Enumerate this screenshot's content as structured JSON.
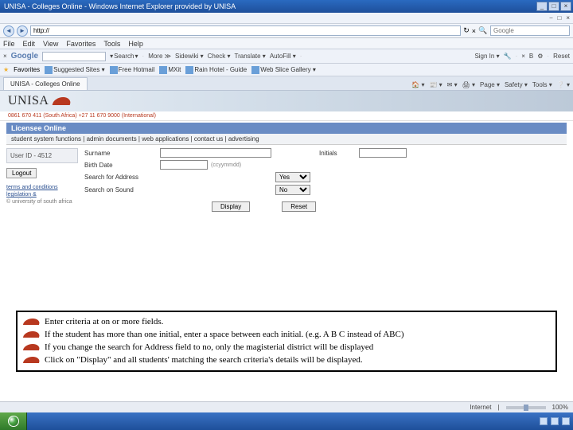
{
  "window": {
    "title": "UNISA - Colleges Online - Windows Internet Explorer provided by UNISA",
    "min": "_",
    "max": "□",
    "close": "×"
  },
  "infobar": {
    "a": "⎯",
    "b": "□",
    "c": "×"
  },
  "addr": {
    "back": "◄",
    "fwd": "►",
    "url": "http://",
    "refresh": "↻",
    "stop": "×",
    "search_placeholder": "Google",
    "mag": "🔍"
  },
  "menu": {
    "file": "File",
    "edit": "Edit",
    "view": "View",
    "favorites": "Favorites",
    "tools": "Tools",
    "help": "Help"
  },
  "tb": {
    "brand": "Google",
    "search": "Search",
    "more": "More ≫",
    "sidewiki": "Sidewiki ▾",
    "check": "Check ▾",
    "translate": "Translate ▾",
    "autofill": "AutoFill ▾",
    "signin": "Sign In ▾",
    "wrench": "🔧",
    "x": "×",
    "gear": "⚙",
    "bold": "B",
    "reset": "Reset"
  },
  "fav": {
    "label": "Favorites",
    "items": [
      "Suggested Sites ▾",
      "Free Hotmail",
      "MXit",
      "Rain Hotel - Guide",
      "Web Slice Gallery ▾"
    ]
  },
  "tab": {
    "title": "UNISA - Colleges Online"
  },
  "tabtools": {
    "home": "🏠 ▾",
    "feeds": "📰 ▾",
    "mail": "✉ ▾",
    "print": "🖨 ▾",
    "page": "Page ▾",
    "safety": "Safety ▾",
    "tools": "Tools ▾",
    "help": "❔ ▾"
  },
  "brand": {
    "name": "UNISA"
  },
  "phones": "0861 670 411 (South Africa) +27 11 670 9000 (International)",
  "colhdr": "Licensee Online",
  "subnav": "student system functions | admin documents | web applications | contact us | advertising",
  "sidebar": {
    "user": "User ID - 4512",
    "logout": "Logout",
    "link1": "terms and conditions",
    "link2": "legislation &",
    "copy": "© university of south africa"
  },
  "form": {
    "surname": "Surname",
    "initials": "Initials",
    "birth": "Birth Date",
    "birth_hint": "(ccyymmdd)",
    "addr": "Search for Address",
    "sound": "Search on Sound",
    "yes": "Yes",
    "no": "No",
    "display": "Display",
    "reset": "Reset"
  },
  "notes": {
    "l1": "Enter criteria at on or more fields.",
    "l2": "If the student has more than one initial, enter a space between each initial. (e.g. A B C instead of ABC)",
    "l3": "If you change the search for Address field to no, only the magisterial district will be displayed",
    "l4": "Click on \"Display\" and all students' matching the search criteria's details will be displayed."
  },
  "status": {
    "internet": "Internet",
    "zoom": "100%"
  }
}
